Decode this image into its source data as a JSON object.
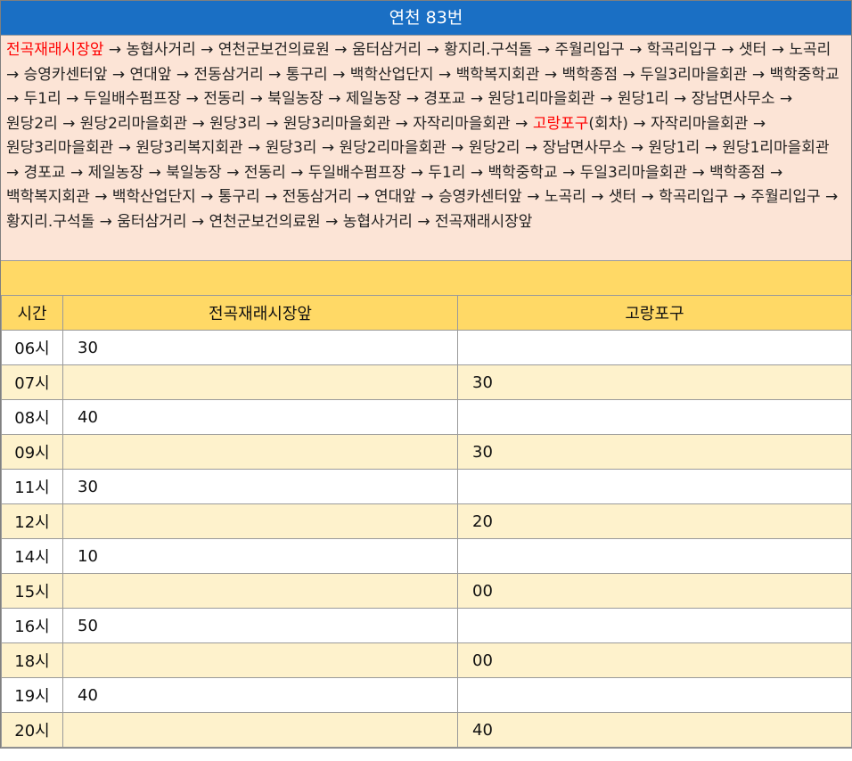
{
  "title": "연천 83번",
  "route": {
    "start_stop": "전곡재래시장앞",
    "segment_1": " → 농협사거리 → 연천군보건의료원 → 움터삼거리 → 황지리.구석돌 → 주월리입구 → 학곡리입구 → 샛터 → 노곡리 → 승영카센터앞 → 연대앞 → 전동삼거리 → 통구리 → 백학산업단지 → 백학복지회관 → 백학종점 → 두일3리마을회관 → 백학중학교 → 두1리 → 두일배수펌프장 → 전동리 → 북일농장 → 제일농장 → 경포교 → 원당1리마을회관 → 원당1리 → 장남면사무소 → 원당2리 → 원당2리마을회관 → 원당3리 → 원당3리마을회관 → 자작리마을회관 → ",
    "turn_stop": "고랑포구",
    "segment_2": "(회차) → 자작리마을회관 → 원당3리마을회관 → 원당3리복지회관 → 원당3리 → 원당2리마을회관 → 원당2리 → 장남면사무소 → 원당1리 → 원당1리마을회관 → 경포교 → 제일농장 → 북일농장 → 전동리 → 두일배수펌프장 → 두1리 → 백학중학교 → 두일3리마을회관 → 백학종점 → 백학복지회관 → 백학산업단지 → 통구리 → 전동삼거리 → 연대앞 → 승영카센터앞 → 노곡리 → 샛터 → 학곡리입구 → 주월리입구 → 황지리.구석돌 → 움터삼거리 → 연천군보건의료원 → 농협사거리 → 전곡재래시장앞"
  },
  "table": {
    "headers": [
      "시간",
      "전곡재래시장앞",
      "고랑포구"
    ],
    "rows": [
      {
        "time": "06시",
        "a": "30",
        "b": ""
      },
      {
        "time": "07시",
        "a": "",
        "b": "30"
      },
      {
        "time": "08시",
        "a": "40",
        "b": ""
      },
      {
        "time": "09시",
        "a": "",
        "b": "30"
      },
      {
        "time": "11시",
        "a": "30",
        "b": ""
      },
      {
        "time": "12시",
        "a": "",
        "b": "20"
      },
      {
        "time": "14시",
        "a": "10",
        "b": ""
      },
      {
        "time": "15시",
        "a": "",
        "b": "00"
      },
      {
        "time": "16시",
        "a": "50",
        "b": ""
      },
      {
        "time": "18시",
        "a": "",
        "b": "00"
      },
      {
        "time": "19시",
        "a": "40",
        "b": ""
      },
      {
        "time": "20시",
        "a": "",
        "b": "40"
      }
    ]
  },
  "colors": {
    "title_bg": "#1a6fc4",
    "route_bg": "#fce4d6",
    "highlight": "#ff0000",
    "header_bg": "#ffd966",
    "alt_row_bg": "#fef2cc"
  }
}
